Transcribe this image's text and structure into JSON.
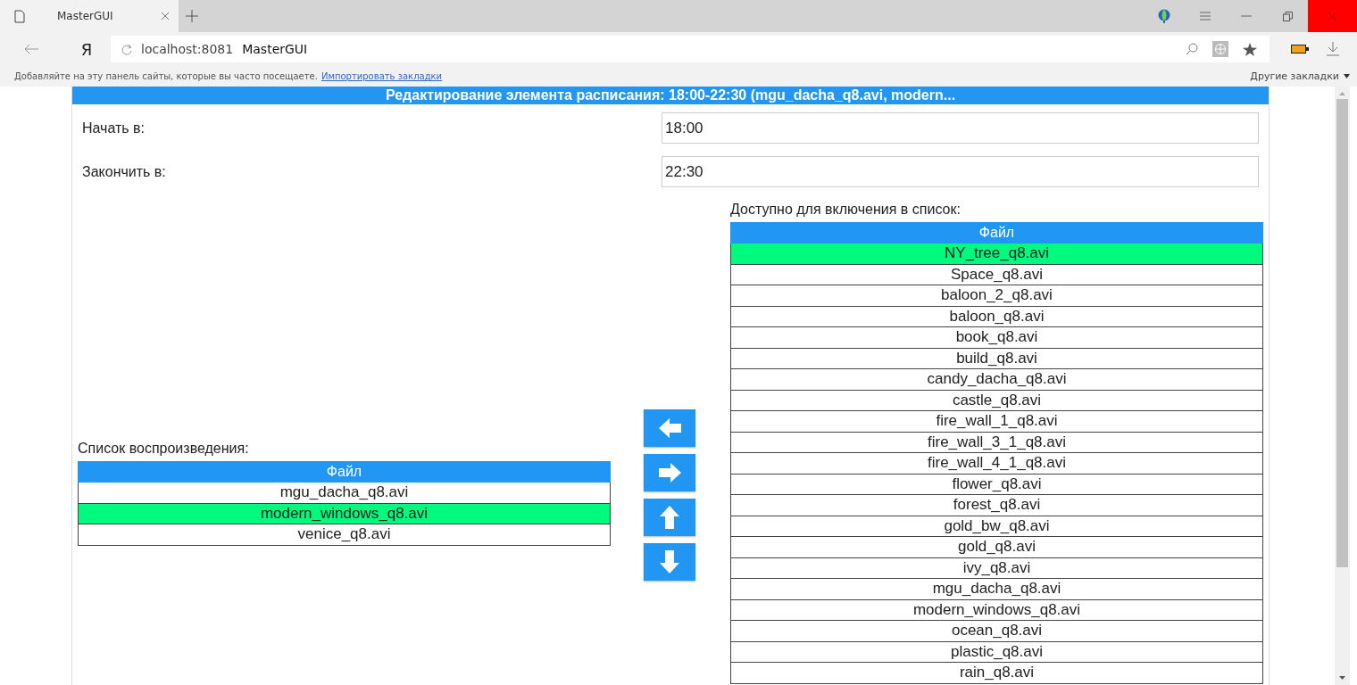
{
  "browser": {
    "tab": {
      "title": "MasterGUI"
    },
    "yandex_button": "Я",
    "address": {
      "host": "localhost:8081",
      "page_title": "MasterGUI"
    },
    "bookmarks_bar": {
      "hint": "Добавляйте на эту панель сайты, которые вы часто посещаете.",
      "import_link": "Импортировать закладки",
      "other_bookmarks": "Другие закладки"
    }
  },
  "dialog": {
    "title": "Редактирование элемента расписания: 18:00-22:30 (mgu_dacha_q8.avi, modern...",
    "fields": [
      {
        "label": "Начать в:",
        "value": "18:00"
      },
      {
        "label": "Закончить в:",
        "value": "22:30"
      }
    ],
    "playlist": {
      "label": "Список воспроизведения:",
      "column": "Файл",
      "rows": [
        {
          "file": "mgu_dacha_q8.avi",
          "selected": false
        },
        {
          "file": "modern_windows_q8.avi",
          "selected": true
        },
        {
          "file": "venice_q8.avi",
          "selected": false
        }
      ]
    },
    "move_buttons": [
      {
        "kind": "left"
      },
      {
        "kind": "right"
      },
      {
        "kind": "up"
      },
      {
        "kind": "down"
      }
    ],
    "available": {
      "label": "Доступно для включения в список:",
      "column": "Файл",
      "rows": [
        {
          "file": "NY_tree_q8.avi",
          "selected": true
        },
        {
          "file": "Space_q8.avi",
          "selected": false
        },
        {
          "file": "baloon_2_q8.avi",
          "selected": false
        },
        {
          "file": "baloon_q8.avi",
          "selected": false
        },
        {
          "file": "book_q8.avi",
          "selected": false
        },
        {
          "file": "build_q8.avi",
          "selected": false
        },
        {
          "file": "candy_dacha_q8.avi",
          "selected": false
        },
        {
          "file": "castle_q8.avi",
          "selected": false
        },
        {
          "file": "fire_wall_1_q8.avi",
          "selected": false
        },
        {
          "file": "fire_wall_3_1_q8.avi",
          "selected": false
        },
        {
          "file": "fire_wall_4_1_q8.avi",
          "selected": false
        },
        {
          "file": "flower_q8.avi",
          "selected": false
        },
        {
          "file": "forest_q8.avi",
          "selected": false
        },
        {
          "file": "gold_bw_q8.avi",
          "selected": false
        },
        {
          "file": "gold_q8.avi",
          "selected": false
        },
        {
          "file": "ivy_q8.avi",
          "selected": false
        },
        {
          "file": "mgu_dacha_q8.avi",
          "selected": false
        },
        {
          "file": "modern_windows_q8.avi",
          "selected": false
        },
        {
          "file": "ocean_q8.avi",
          "selected": false
        },
        {
          "file": "plastic_q8.avi",
          "selected": false
        },
        {
          "file": "rain_q8.avi",
          "selected": false
        }
      ]
    }
  }
}
